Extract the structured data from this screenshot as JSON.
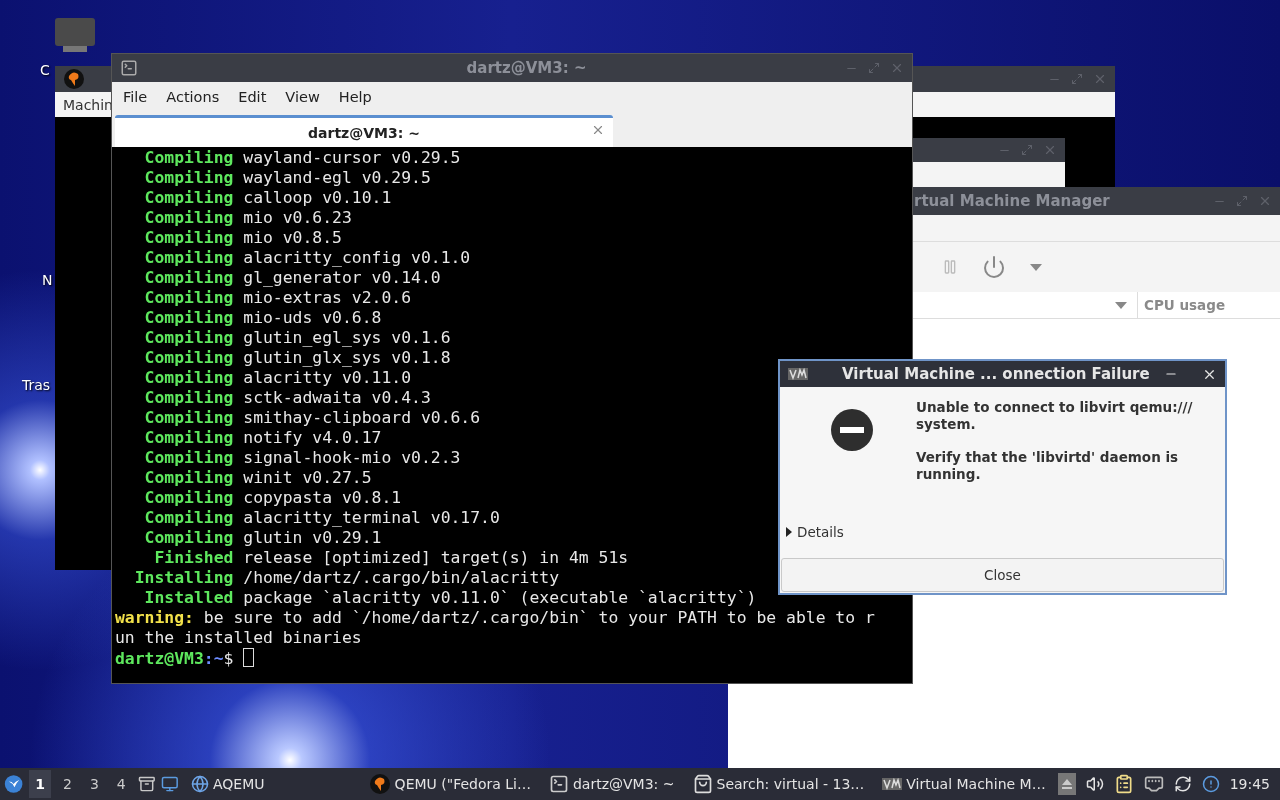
{
  "desktop_icons": [
    {
      "label": "C"
    },
    {
      "label": "N"
    },
    {
      "label": "Tras"
    }
  ],
  "qemu_window": {
    "menu_item": "Machin"
  },
  "vmm_window": {
    "title": "rtual Machine Manager",
    "column": "CPU usage"
  },
  "terminal": {
    "title": "dartz@VM3: ~",
    "menu": [
      "File",
      "Actions",
      "Edit",
      "View",
      "Help"
    ],
    "tabs": [
      {
        "label": "dartz@VM3: ~",
        "selected": true
      }
    ],
    "lines": [
      {
        "kind": "cargo",
        "status": "Compiling",
        "text": "wayland-cursor v0.29.5"
      },
      {
        "kind": "cargo",
        "status": "Compiling",
        "text": "wayland-egl v0.29.5"
      },
      {
        "kind": "cargo",
        "status": "Compiling",
        "text": "calloop v0.10.1"
      },
      {
        "kind": "cargo",
        "status": "Compiling",
        "text": "mio v0.6.23"
      },
      {
        "kind": "cargo",
        "status": "Compiling",
        "text": "mio v0.8.5"
      },
      {
        "kind": "cargo",
        "status": "Compiling",
        "text": "alacritty_config v0.1.0"
      },
      {
        "kind": "cargo",
        "status": "Compiling",
        "text": "gl_generator v0.14.0"
      },
      {
        "kind": "cargo",
        "status": "Compiling",
        "text": "mio-extras v2.0.6"
      },
      {
        "kind": "cargo",
        "status": "Compiling",
        "text": "mio-uds v0.6.8"
      },
      {
        "kind": "cargo",
        "status": "Compiling",
        "text": "glutin_egl_sys v0.1.6"
      },
      {
        "kind": "cargo",
        "status": "Compiling",
        "text": "glutin_glx_sys v0.1.8"
      },
      {
        "kind": "cargo",
        "status": "Compiling",
        "text": "alacritty v0.11.0"
      },
      {
        "kind": "cargo",
        "status": "Compiling",
        "text": "sctk-adwaita v0.4.3"
      },
      {
        "kind": "cargo",
        "status": "Compiling",
        "text": "smithay-clipboard v0.6.6"
      },
      {
        "kind": "cargo",
        "status": "Compiling",
        "text": "notify v4.0.17"
      },
      {
        "kind": "cargo",
        "status": "Compiling",
        "text": "signal-hook-mio v0.2.3"
      },
      {
        "kind": "cargo",
        "status": "Compiling",
        "text": "winit v0.27.5"
      },
      {
        "kind": "cargo",
        "status": "Compiling",
        "text": "copypasta v0.8.1"
      },
      {
        "kind": "cargo",
        "status": "Compiling",
        "text": "alacritty_terminal v0.17.0"
      },
      {
        "kind": "cargo",
        "status": "Compiling",
        "text": "glutin v0.29.1"
      },
      {
        "kind": "cargo",
        "status": "Finished",
        "text": "release [optimized] target(s) in 4m 51s"
      },
      {
        "kind": "cargo",
        "status": "Installing",
        "text": "/home/dartz/.cargo/bin/alacritty"
      },
      {
        "kind": "cargo",
        "status": "Installed",
        "text": "package `alacritty v0.11.0` (executable `alacritty`)"
      },
      {
        "kind": "warning",
        "status": "warning:",
        "text": "be sure to add `/home/dartz/.cargo/bin` to your PATH to be able to r"
      },
      {
        "kind": "plain",
        "text": "un the installed binaries"
      },
      {
        "kind": "prompt",
        "user": "dartz@VM3",
        "path": ":~",
        "symbol": "$"
      }
    ]
  },
  "dialog": {
    "title": "Virtual Machine ... onnection Failure",
    "messages": [
      "Unable to connect to libvirt qemu:/// system.",
      "Verify that the 'libvirtd' daemon is running."
    ],
    "expander": {
      "label": "Details",
      "expanded": false
    },
    "button": "Close"
  },
  "taskbar": {
    "workspaces": [
      {
        "label": "1",
        "selected": true
      },
      {
        "label": "2",
        "selected": false
      },
      {
        "label": "3",
        "selected": false
      },
      {
        "label": "4",
        "selected": false
      }
    ],
    "launchers": [
      {
        "label": "AQEMU"
      }
    ],
    "tasks": [
      {
        "kind": "qemu",
        "label": "QEMU (\"Fedora Li…"
      },
      {
        "kind": "terminal",
        "label": "dartz@VM3: ~"
      },
      {
        "kind": "search",
        "label": "Search: virtual - 13…"
      },
      {
        "kind": "vmm",
        "label": "Virtual Machine M…"
      }
    ],
    "clock": "19:45"
  }
}
